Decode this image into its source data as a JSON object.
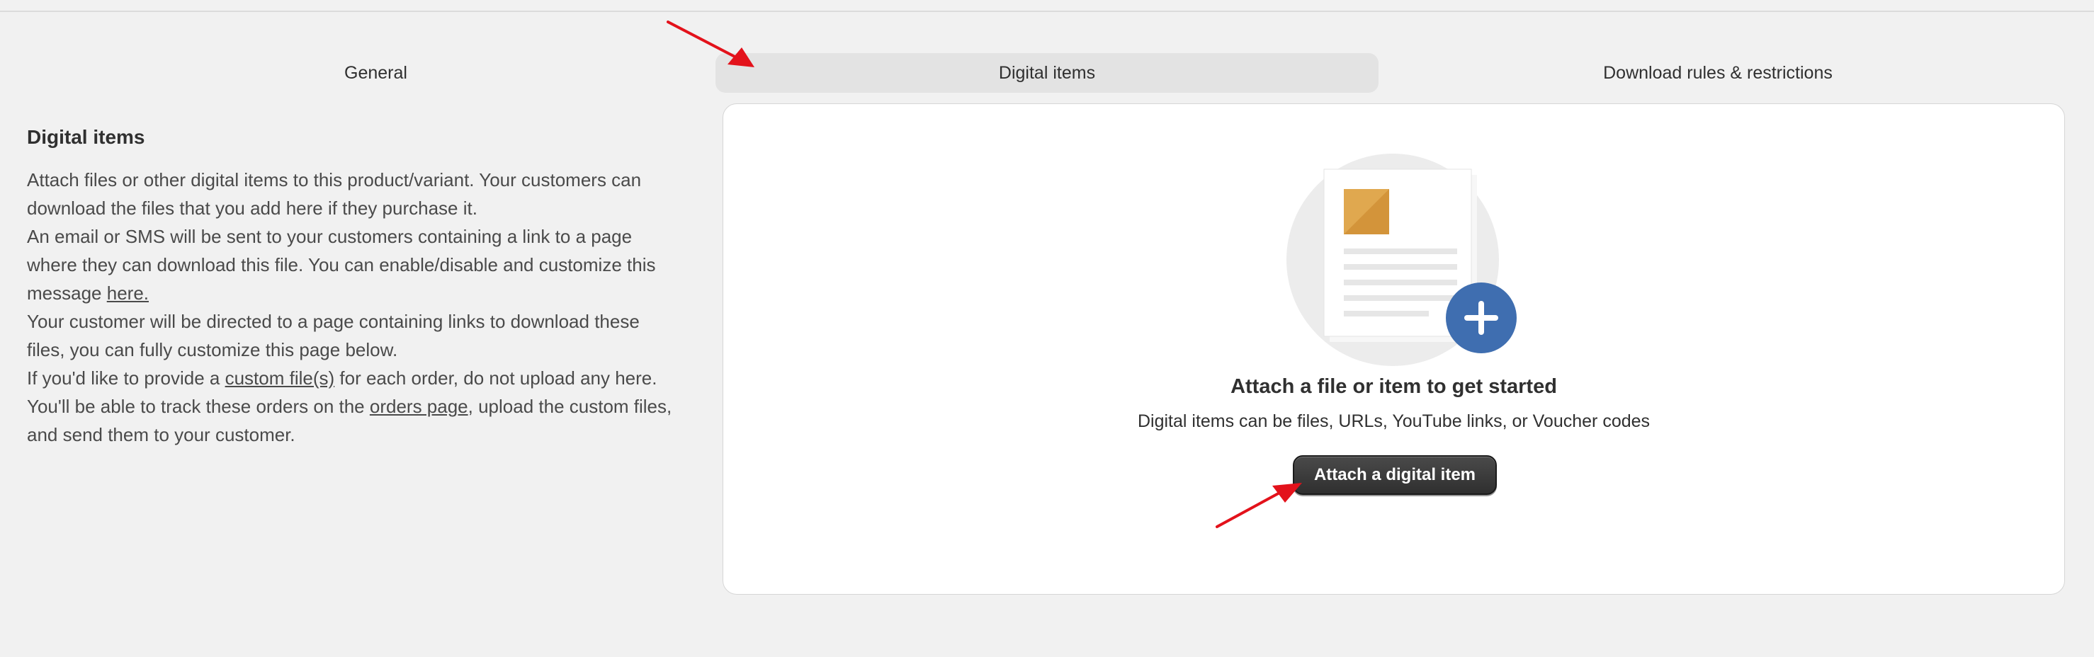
{
  "tabs": [
    {
      "label": "General",
      "active": false
    },
    {
      "label": "Digital items",
      "active": true
    },
    {
      "label": "Download rules & restrictions",
      "active": false
    }
  ],
  "description": {
    "title": "Digital items",
    "p1": "Attach files or other digital items to this product/variant. Your customers can download the files that you add here if they purchase it.",
    "p2_text": "An email or SMS will be sent to your customers containing a link to a page where they can download this file. You can enable/disable and customize this message ",
    "p2_link": "here.",
    "p3": "Your customer will be directed to a page containing links to download these files, you can fully customize this page below.",
    "p4_a": "If you'd like to provide a ",
    "p4_link1": "custom file(s)",
    "p4_b": " for each order, do not upload any here. You'll be able to track these orders on the ",
    "p4_link2": "orders page",
    "p4_c": ", upload the custom files, and send them to your customer."
  },
  "empty_state": {
    "title": "Attach a file or item to get started",
    "subtitle": "Digital items can be files, URLs, YouTube links, or Voucher codes",
    "button_label": "Attach a digital item",
    "icon": "document-plus-icon"
  },
  "colors": {
    "annotation_arrow": "#e3121b",
    "plus_badge": "#3f6eb0",
    "doc_thumbnail": "#e0a84f",
    "button_dark": "#303030"
  }
}
